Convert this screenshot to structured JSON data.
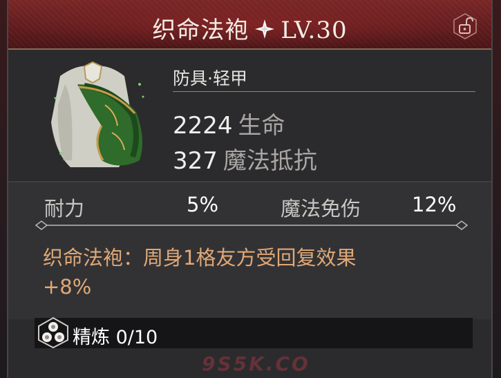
{
  "header": {
    "title": "织命法袍",
    "level": "LV.30",
    "star_icon": "sparkle-star-icon",
    "lock_icon": "unlock-icon"
  },
  "item": {
    "image_icon": "green-shawl-armor-image",
    "category": "防具·轻甲",
    "stats": [
      {
        "value": "2224",
        "label": "生命"
      },
      {
        "value": "327",
        "label": "魔法抵抗"
      }
    ]
  },
  "attributes": [
    {
      "label": "耐力",
      "value": "5%"
    },
    {
      "label": "魔法免伤",
      "value": "12%"
    }
  ],
  "effect": {
    "line1": "织命法袍：周身1格友方受回复效果",
    "line2": "+8%"
  },
  "refine": {
    "icon": "refine-hexagon-icon",
    "label": "精炼",
    "value": "0/10"
  },
  "watermark": "9S5K.CO",
  "colors": {
    "title_bar": "#6a1f21",
    "panel": "#2b2b2d",
    "effect_text": "#e0a877",
    "stat_label": "#a9a6a3"
  }
}
